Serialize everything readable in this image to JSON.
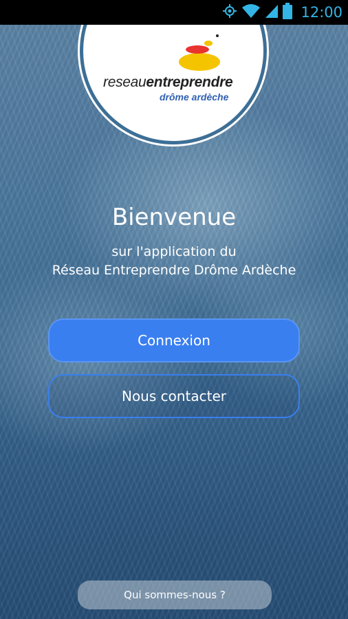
{
  "status_bar": {
    "time": "12:00",
    "icons": [
      "location-icon",
      "wifi-icon",
      "signal-icon",
      "battery-icon"
    ],
    "color": "#33b5e5"
  },
  "logo": {
    "word_regular": "reseau",
    "word_bold": "entreprendre",
    "region": "drôme ardèche",
    "colors": {
      "red": "#e8332f",
      "yellow": "#f5c400",
      "blue": "#2f5fb3"
    }
  },
  "welcome": {
    "title": "Bienvenue",
    "line1": "sur l'application du",
    "line2": "Réseau Entreprendre Drôme Ardèche"
  },
  "buttons": {
    "login_label": "Connexion",
    "contact_label": "Nous contacter",
    "about_label": "Qui sommes-nous ?"
  },
  "colors": {
    "primary_button": "#3a7ff0",
    "background": "#3f6d95"
  }
}
